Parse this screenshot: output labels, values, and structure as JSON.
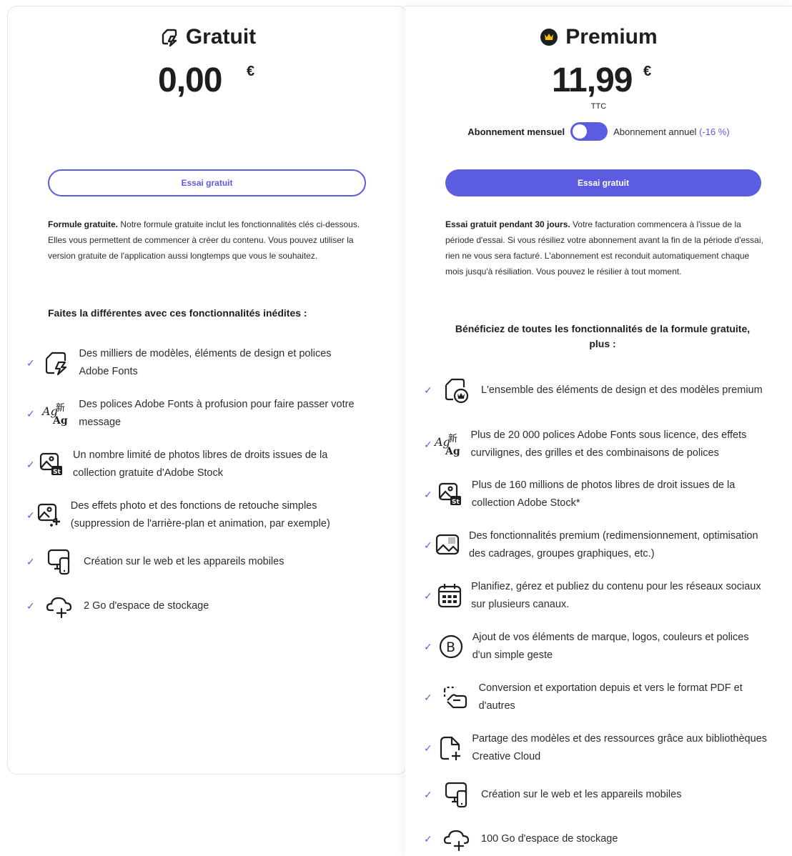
{
  "free": {
    "title": "Gratuit",
    "price": "0,00",
    "currency": "€",
    "button": "Essai gratuit",
    "desc_bold": "Formule gratuite.",
    "desc_rest": " Notre formule gratuite inclut les fonctionnalités clés ci-dessous. Elles vous permettent de commencer à créer du contenu. Vous pouvez utiliser la version gratuite de l'application aussi longtemps que vous le souhaitez.",
    "features_heading": "Faites la différentes avec ces fonctionnalités inédites :",
    "features": [
      {
        "icon": "template-shapes-icon",
        "text": "Des milliers de modèles, éléments de design et polices Adobe Fonts"
      },
      {
        "icon": "fonts-icon",
        "text": "Des polices Adobe Fonts à profusion pour faire passer votre message"
      },
      {
        "icon": "adobe-stock-icon",
        "text": "Un nombre limité de photos libres de droits issues de la collection gratuite d'Adobe Stock"
      },
      {
        "icon": "photo-effects-icon",
        "text": "Des effets photo et des fonctions de retouche simples (suppression de l'arrière-plan et animation, par exemple)"
      },
      {
        "icon": "devices-icon",
        "text": "Création sur le web et les appareils mobiles"
      },
      {
        "icon": "cloud-storage-icon",
        "text": "2 Go d'espace de stockage"
      }
    ]
  },
  "premium": {
    "title": "Premium",
    "price": "11,99",
    "currency": "€",
    "tax_label": "TTC",
    "toggle_monthly": "Abonnement mensuel",
    "toggle_annual": "Abonnement annuel",
    "toggle_discount": "(-16 %)",
    "button": "Essai gratuit",
    "desc_bold": "Essai gratuit pendant 30 jours.",
    "desc_rest": " Votre facturation commencera à l'issue de la période d'essai. Si vous résiliez votre abonnement avant la fin de la période d'essai, rien ne vous sera facturé. L'abonnement est reconduit automatiquement chaque mois jusqu'à résiliation. Vous pouvez le résilier à tout moment.",
    "features_heading": "Bénéficiez de toutes les fonctionnalités de la formule gratuite, plus :",
    "features": [
      {
        "icon": "premium-templates-icon",
        "text": "L'ensemble des éléments de design et des modèles premium"
      },
      {
        "icon": "fonts-icon",
        "text": "Plus de 20 000 polices Adobe Fonts sous licence, des effets curvilignes, des grilles et des combinaisons de polices"
      },
      {
        "icon": "adobe-stock-icon",
        "text": "Plus de 160 millions de photos libres de droit issues de la collection Adobe Stock*"
      },
      {
        "icon": "resize-image-icon",
        "text": "Des fonctionnalités premium (redimensionnement, optimisation des cadrages, groupes graphiques, etc.)"
      },
      {
        "icon": "calendar-icon",
        "text": "Planifiez, gérez et publiez du contenu pour les réseaux sociaux sur plusieurs canaux."
      },
      {
        "icon": "brand-icon",
        "text": "Ajout de vos éléments de marque, logos, couleurs et polices d'un simple geste"
      },
      {
        "icon": "convert-export-icon",
        "text": "Conversion et exportation depuis et vers le format PDF et d'autres"
      },
      {
        "icon": "share-libraries-icon",
        "text": "Partage des modèles et des ressources grâce aux bibliothèques Creative Cloud"
      },
      {
        "icon": "devices-icon",
        "text": "Création sur le web et les appareils mobiles"
      },
      {
        "icon": "cloud-storage-icon",
        "text": "100 Go d'espace de stockage"
      }
    ]
  },
  "colors": {
    "accent": "#5c5ce0",
    "text": "#2c2c2c"
  }
}
